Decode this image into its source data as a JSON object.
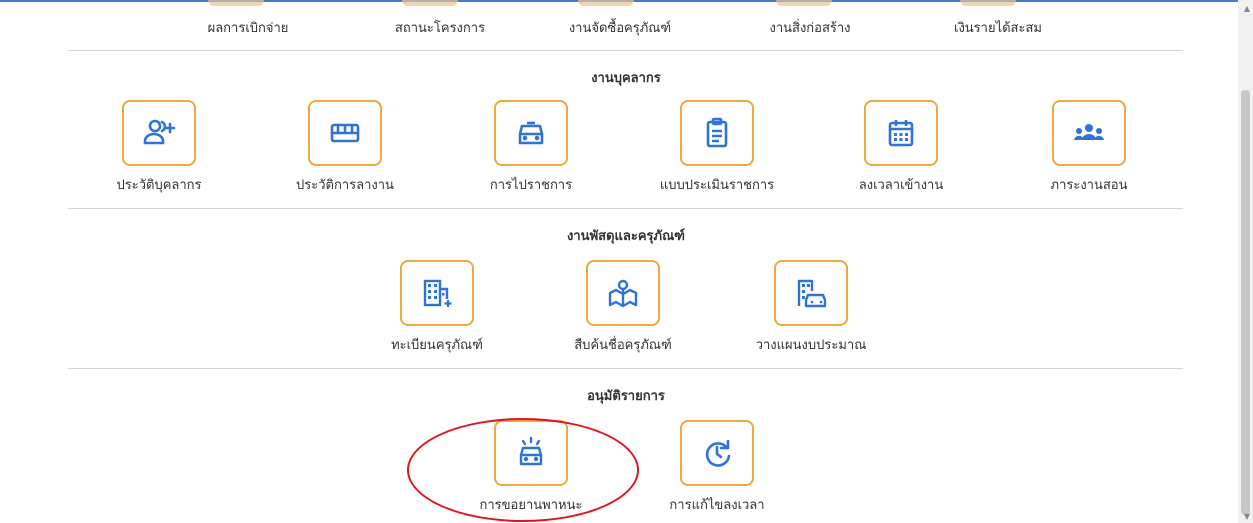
{
  "top_row": {
    "items": [
      "ผลการเบิกจ่าย",
      "สถานะโครงการ",
      "งานจัดซื้อครุภัณฑ์",
      "งานสิ่งก่อสร้าง",
      "เงินรายได้สะสม"
    ]
  },
  "sections": {
    "personnel": {
      "title": "งานบุคลากร",
      "items": [
        "ประวัติบุคลากร",
        "ประวัติการลางาน",
        "การไปราชการ",
        "แบบประเมินราชการ",
        "ลงเวลาเข้างาน",
        "ภาระงานสอน"
      ],
      "icons": [
        "add-user-icon",
        "bed-icon",
        "car-icon",
        "clipboard-icon",
        "calendar-icon",
        "group-icon"
      ]
    },
    "supplies": {
      "title": "งานพัสดุและครุภัณฑ์",
      "items": [
        "ทะเบียนครุภัณฑ์",
        "สืบค้นชื่อครุภัณฑ์",
        "วางแผนงบประมาณ"
      ],
      "icons": [
        "building-plus-icon",
        "map-pin-book-icon",
        "building-car-icon"
      ]
    },
    "approval": {
      "title": "อนุมัติรายการ",
      "items": [
        "การขอยานพาหนะ",
        "การแก้ไขลงเวลา"
      ],
      "icons": [
        "car-alert-icon",
        "clock-refresh-icon"
      ]
    }
  },
  "colors": {
    "accent": "#f0a840",
    "icon": "#2f73d8",
    "highlight_circle": "#e0141e",
    "top_line": "#4a78c8"
  }
}
